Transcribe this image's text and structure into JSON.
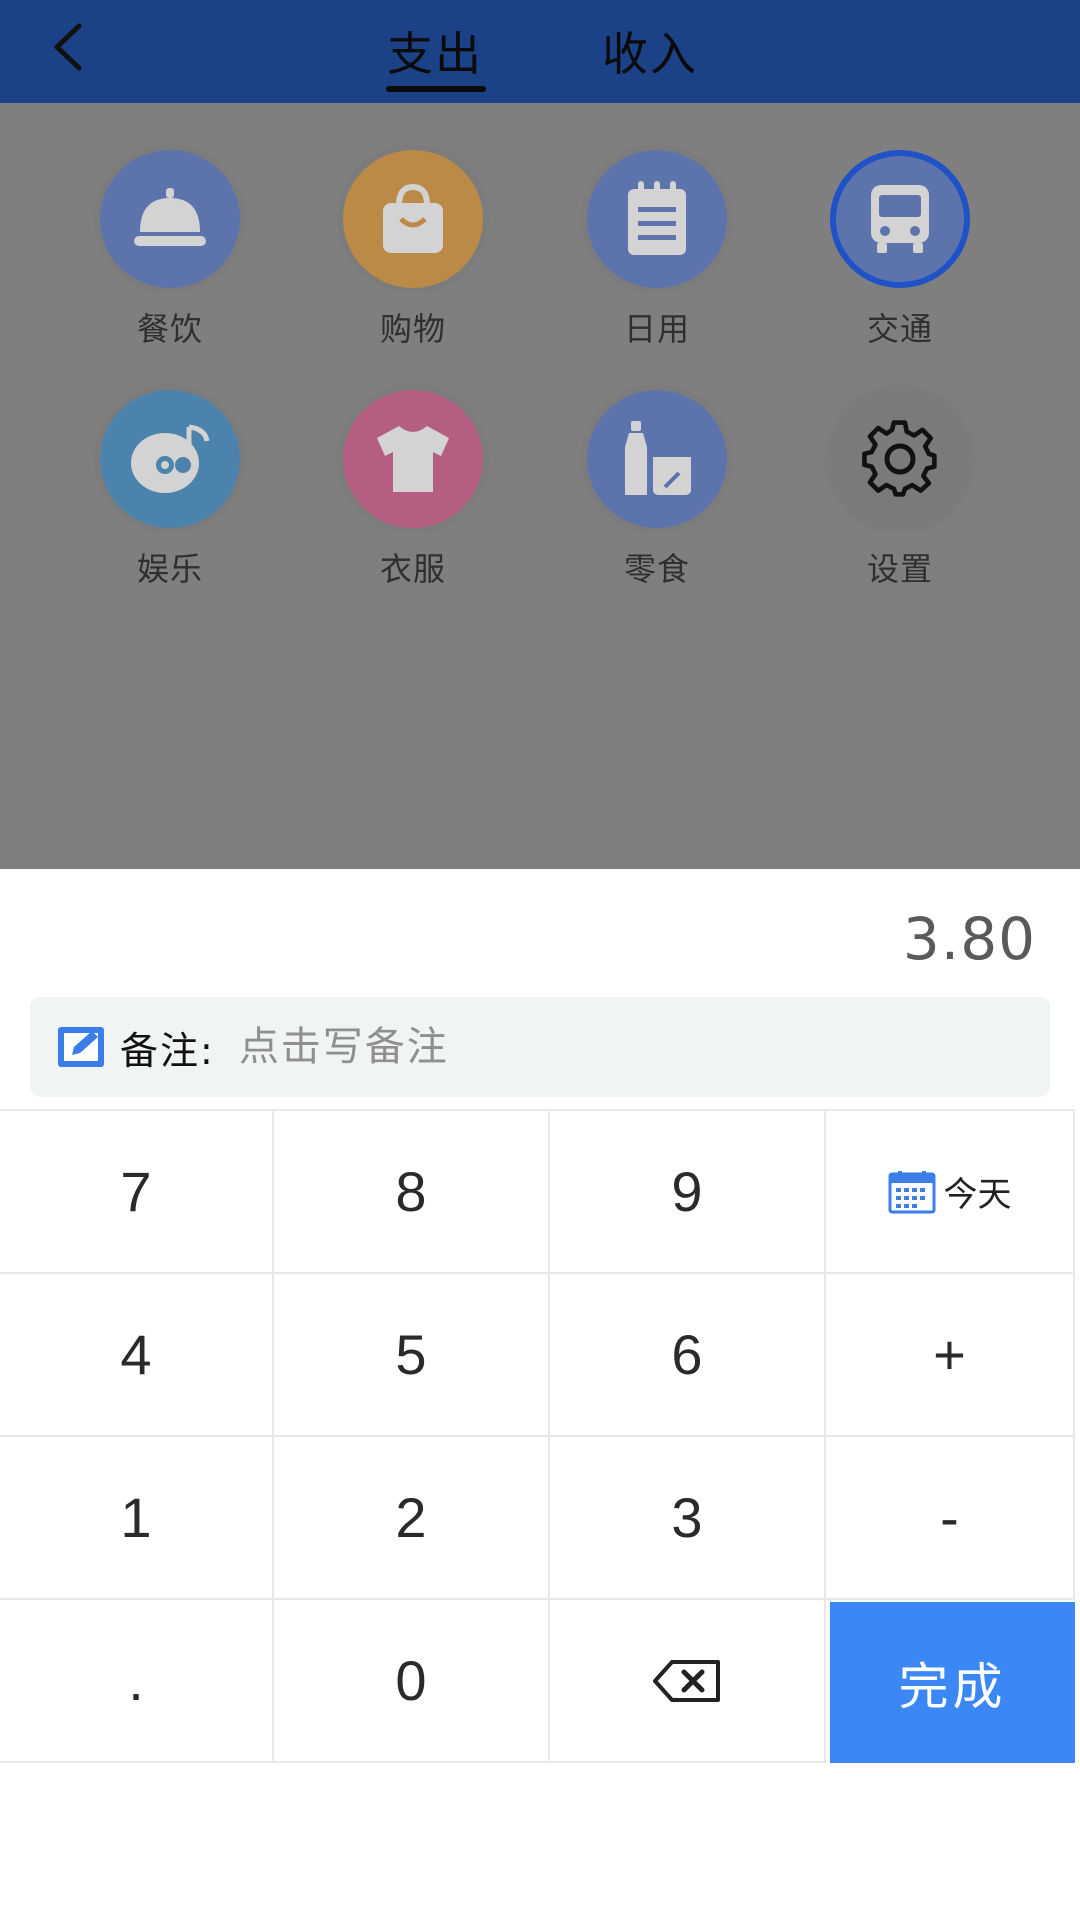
{
  "header": {
    "back_icon": "chevron-left-icon",
    "tabs": [
      {
        "label": "支出",
        "active": true
      },
      {
        "label": "收入",
        "active": false
      }
    ],
    "background_color": "#1b4286"
  },
  "categories": [
    {
      "label": "餐饮",
      "icon": "cloche-icon",
      "color": "#5c73ac",
      "selected": false
    },
    {
      "label": "购物",
      "icon": "shopping-bag-icon",
      "color": "#bb8a47",
      "selected": false
    },
    {
      "label": "日用",
      "icon": "notepad-icon",
      "color": "#5c73ac",
      "selected": false
    },
    {
      "label": "交通",
      "icon": "bus-icon",
      "color": "#5c73ac",
      "selected": true
    },
    {
      "label": "娱乐",
      "icon": "music-disc-icon",
      "color": "#4b83ad",
      "selected": false
    },
    {
      "label": "衣服",
      "icon": "tshirt-icon",
      "color": "#b45f81",
      "selected": false
    },
    {
      "label": "零食",
      "icon": "snack-icon",
      "color": "#5c73ac",
      "selected": false
    },
    {
      "label": "设置",
      "icon": "gear-icon",
      "color": "#7a7a7a",
      "selected": false
    }
  ],
  "panel": {
    "amount": "3.80",
    "note": {
      "label": "备注:",
      "placeholder": "点击写备注",
      "value": ""
    }
  },
  "keypad": {
    "keys": [
      "7",
      "8",
      "9",
      "今天",
      "4",
      "5",
      "6",
      "+",
      "1",
      "2",
      "3",
      "-",
      ".",
      "0",
      "",
      "完成"
    ],
    "accent_color": "#3b87f6"
  }
}
